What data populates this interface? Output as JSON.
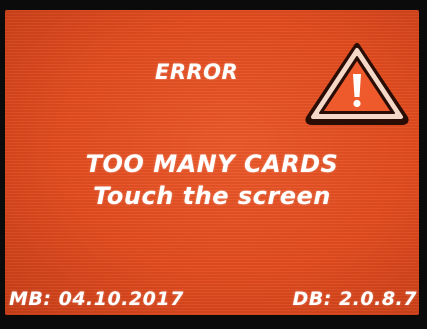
{
  "screen": {
    "title": "ERROR",
    "message_line1": "TOO MANY CARDS",
    "message_line2": "Touch the screen",
    "icon": "warning-triangle-icon"
  },
  "footer": {
    "mb_version": "MB: 04.10.2017",
    "db_version": "DB: 2.0.8.7"
  },
  "colors": {
    "background": "#e44d20",
    "text": "#ffffff",
    "icon_fill": "#ee5a2c",
    "icon_outline": "#f5d8c8"
  }
}
